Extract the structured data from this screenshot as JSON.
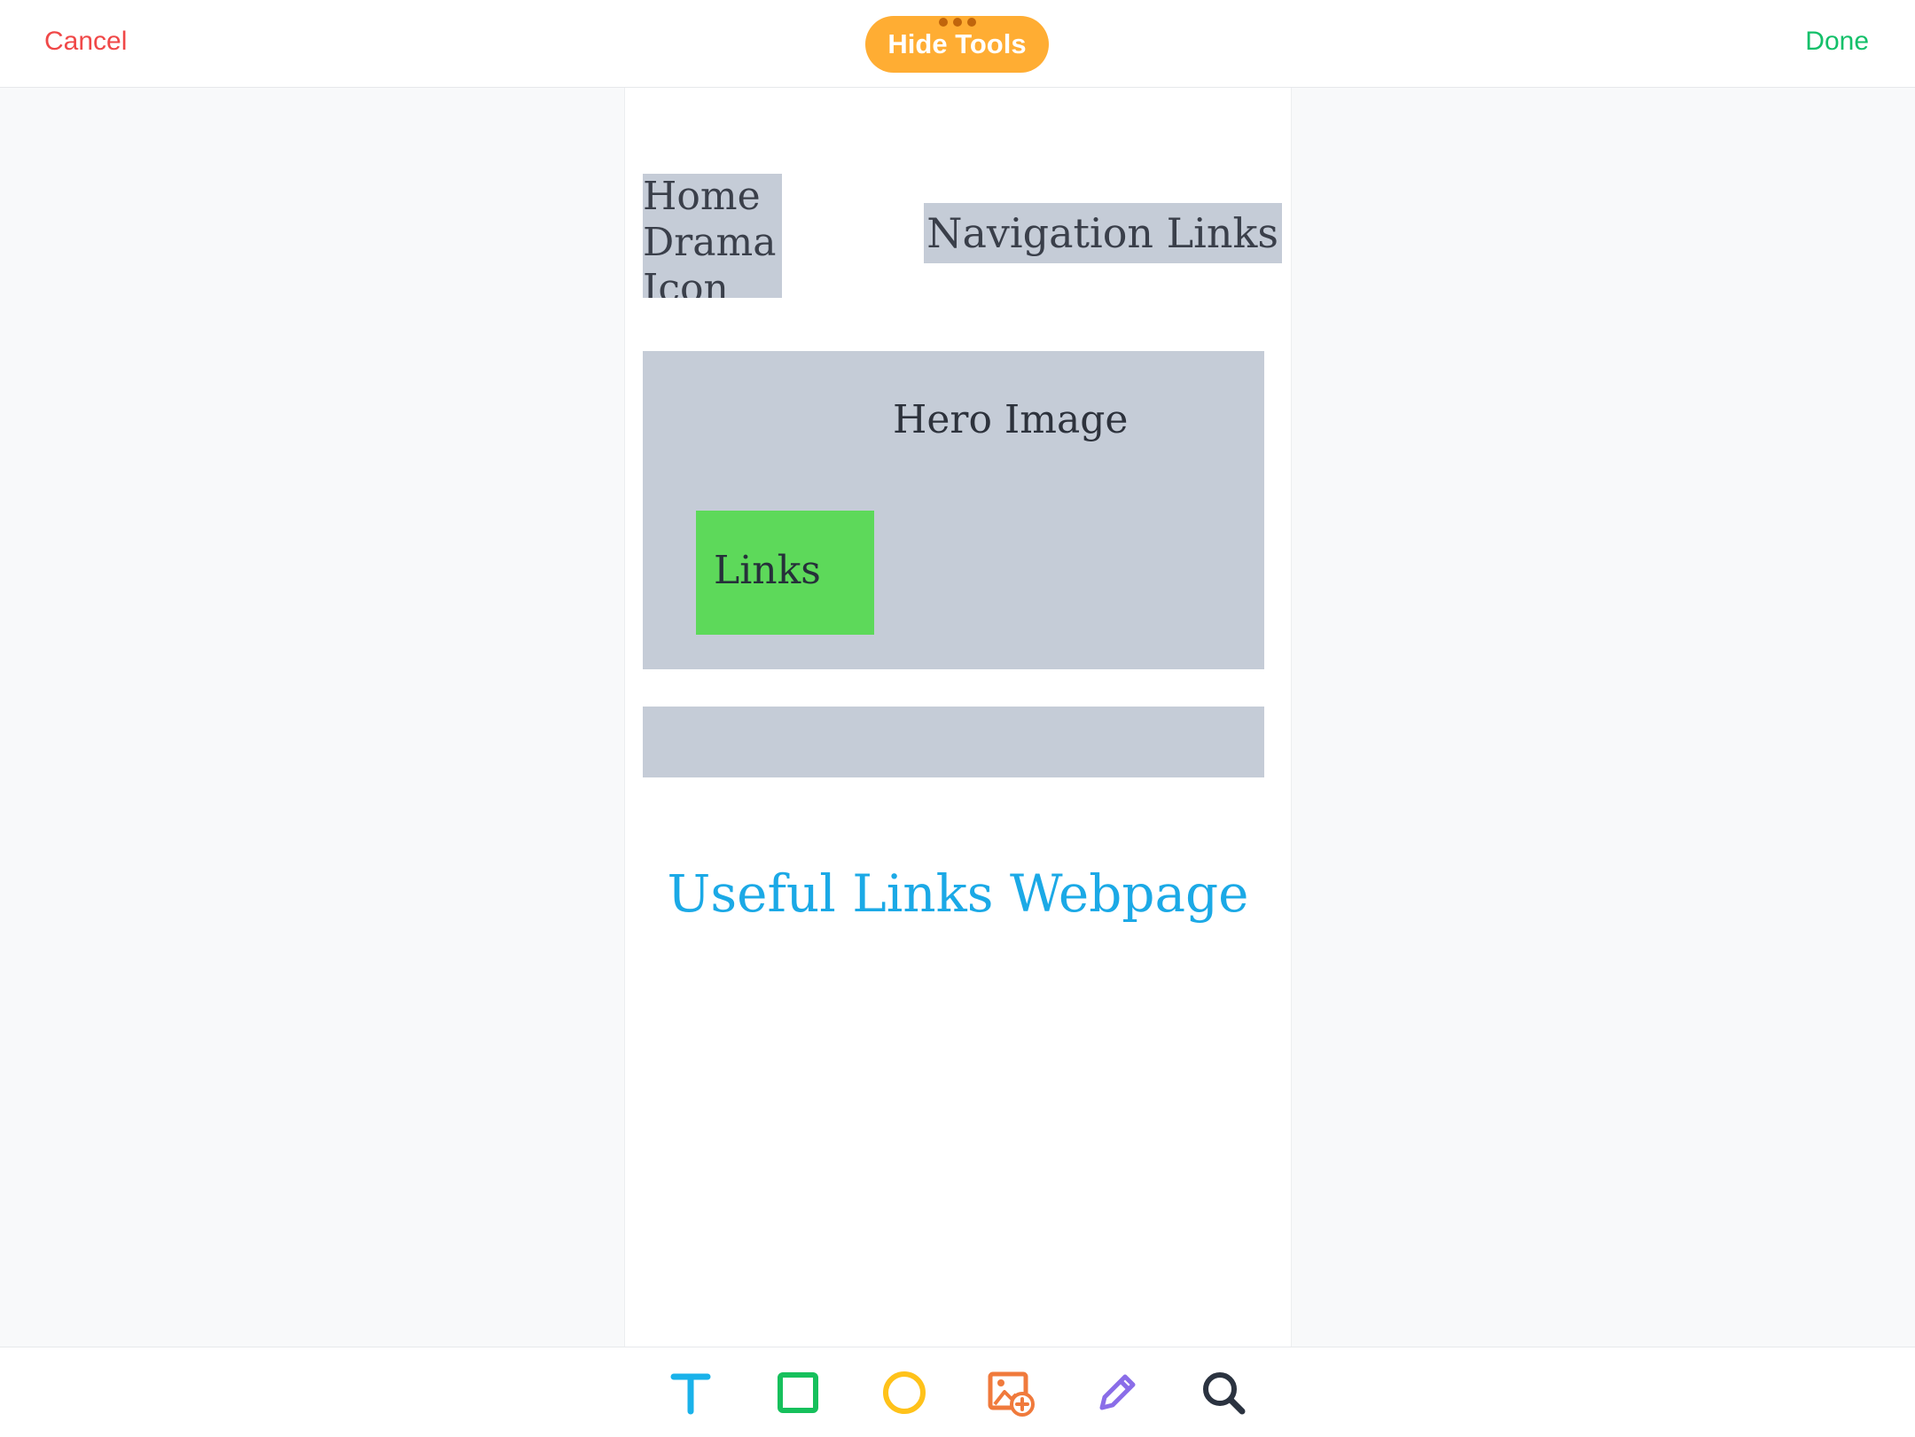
{
  "header": {
    "cancel_label": "Cancel",
    "hide_tools_label": "Hide Tools",
    "done_label": "Done",
    "cancel_color": "#f04848",
    "done_color": "#14c06a",
    "hide_tools_color": "#ffad33"
  },
  "canvas": {
    "home_icon_lines": [
      "Home",
      "Drama",
      "Icon"
    ],
    "navigation_label": "Navigation Links",
    "hero_label": "Hero Image",
    "links_label": "Links",
    "caption": "Useful Links Webpage",
    "caption_color": "#1ba9e6",
    "placeholder_color": "#c5ccd7",
    "links_color": "#5dd95a"
  },
  "toolbar": {
    "tools": [
      {
        "name": "text-tool-icon",
        "color": "#1ab2ea"
      },
      {
        "name": "rectangle-tool-icon",
        "color": "#16c05c"
      },
      {
        "name": "circle-tool-icon",
        "color": "#ffc21a"
      },
      {
        "name": "image-tool-icon",
        "color": "#f07a3c"
      },
      {
        "name": "pencil-tool-icon",
        "color": "#8a6de8"
      },
      {
        "name": "search-tool-icon",
        "color": "#2b3340"
      }
    ]
  }
}
